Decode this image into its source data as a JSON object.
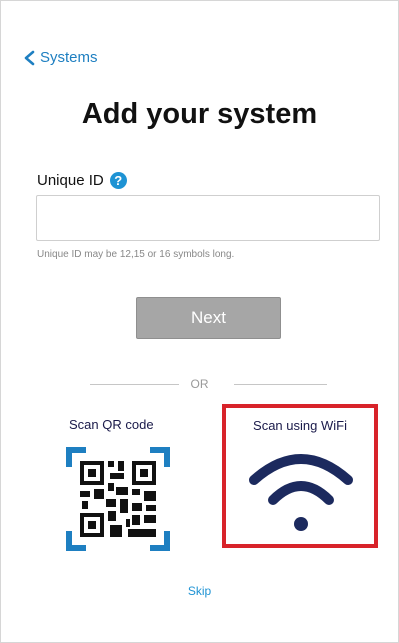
{
  "nav": {
    "back_label": "Systems"
  },
  "page": {
    "title": "Add your system"
  },
  "unique_id": {
    "label": "Unique ID",
    "help_glyph": "?",
    "value": "",
    "placeholder": "",
    "hint": "Unique ID may be 12,15 or 16 symbols long."
  },
  "actions": {
    "next_label": "Next",
    "divider_label": "OR",
    "scan_qr_label": "Scan QR code",
    "scan_wifi_label": "Scan using WiFi",
    "skip_label": "Skip"
  },
  "colors": {
    "link": "#1e7fc1",
    "help_badge": "#1e93d4",
    "next_button": "#a6a6a6",
    "highlight_border": "#d8232a",
    "wifi_icon": "#1c2a5e",
    "qr_bracket": "#1e7fc1"
  },
  "icons": {
    "back": "chevron-left-icon",
    "help": "help-icon",
    "qr": "qr-code-icon",
    "wifi": "wifi-icon"
  }
}
